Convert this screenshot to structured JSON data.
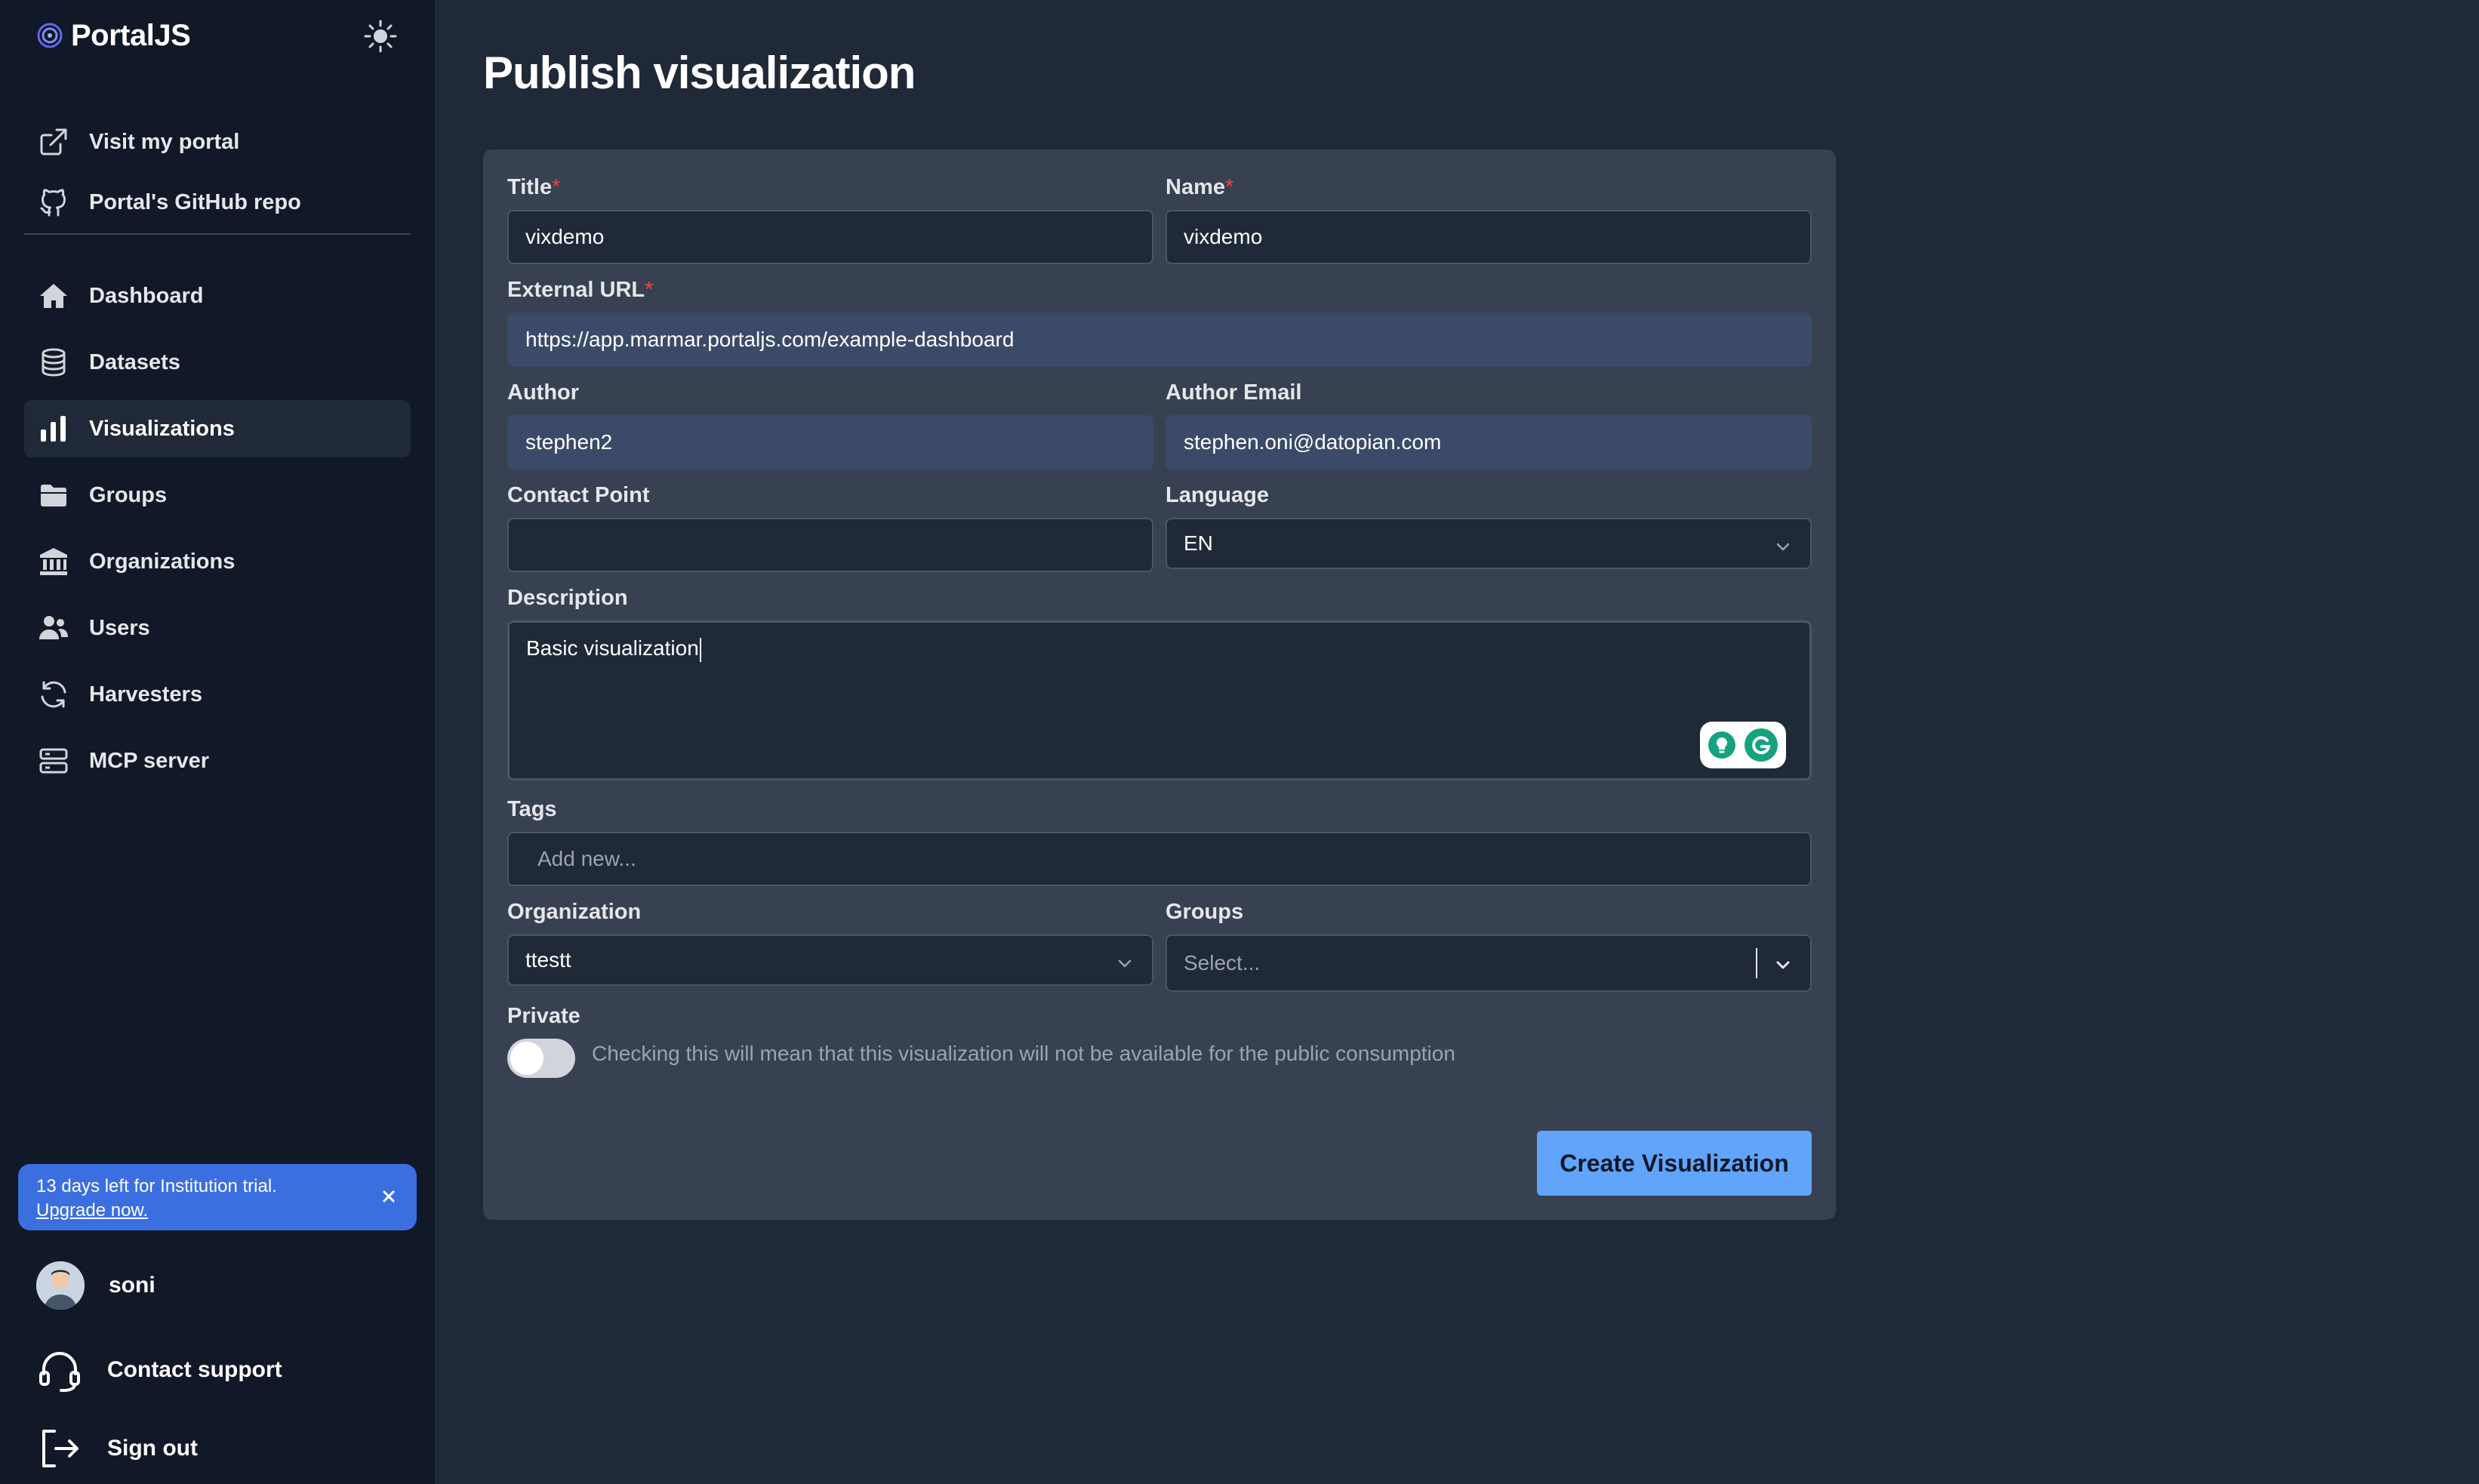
{
  "brand": {
    "name": "PortalJS"
  },
  "sidebar": {
    "top_links": [
      {
        "label": "Visit my portal",
        "icon": "external-link-icon"
      },
      {
        "label": "Portal's GitHub repo",
        "icon": "github-icon"
      }
    ],
    "items": [
      {
        "label": "Dashboard",
        "icon": "home-icon"
      },
      {
        "label": "Datasets",
        "icon": "database-icon"
      },
      {
        "label": "Visualizations",
        "icon": "bar-chart-icon",
        "active": true
      },
      {
        "label": "Groups",
        "icon": "folder-icon"
      },
      {
        "label": "Organizations",
        "icon": "building-icon"
      },
      {
        "label": "Users",
        "icon": "users-icon"
      },
      {
        "label": "Harvesters",
        "icon": "refresh-icon"
      },
      {
        "label": "MCP server",
        "icon": "server-icon"
      }
    ],
    "trial": {
      "message": "13 days left for Institution trial.",
      "link": "Upgrade now."
    },
    "user": {
      "name": "soni"
    },
    "support_label": "Contact support",
    "signout_label": "Sign out"
  },
  "page": {
    "title": "Publish visualization"
  },
  "form": {
    "title": {
      "label": "Title",
      "required": "*",
      "value": "vixdemo"
    },
    "name": {
      "label": "Name",
      "required": "*",
      "value": "vixdemo"
    },
    "external_url": {
      "label": "External URL",
      "required": "*",
      "value": "https://app.marmar.portaljs.com/example-dashboard"
    },
    "author": {
      "label": "Author",
      "value": "stephen2"
    },
    "author_email": {
      "label": "Author Email",
      "value": "stephen.oni@datopian.com"
    },
    "contact_point": {
      "label": "Contact Point",
      "value": ""
    },
    "language": {
      "label": "Language",
      "value": "EN"
    },
    "description": {
      "label": "Description",
      "value": "Basic visualization"
    },
    "tags": {
      "label": "Tags",
      "placeholder": "Add new..."
    },
    "organization": {
      "label": "Organization",
      "value": "ttestt"
    },
    "groups": {
      "label": "Groups",
      "placeholder": "Select..."
    },
    "private": {
      "label": "Private",
      "hint": "Checking this will mean that this visualization will not be available for the public consumption"
    },
    "submit_label": "Create Visualization"
  },
  "colors": {
    "accent": "#60a5fa",
    "trial_banner": "#3b6fe0",
    "required": "#ef4444"
  }
}
